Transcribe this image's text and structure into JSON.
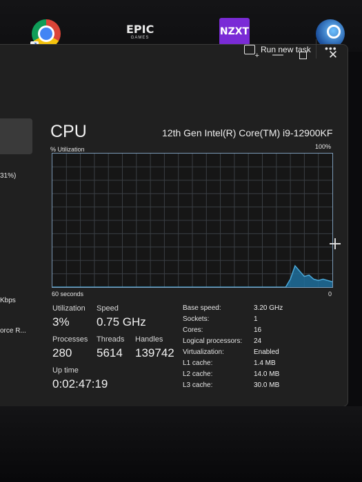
{
  "desktop": {
    "icons": [
      {
        "name": "chrome-icon"
      },
      {
        "name": "epic-games-icon",
        "text1": "EPIC",
        "text2": "GAMES"
      },
      {
        "name": "nzxt-icon",
        "text": "NZXT"
      },
      {
        "name": "steam-icon"
      }
    ]
  },
  "window": {
    "min_glyph": "—",
    "close_glyph": "✕"
  },
  "toolbar": {
    "run_new_task": "Run new task",
    "more": "•••"
  },
  "sidebar": {
    "fragments": [
      "31%)",
      "Kbps",
      "orce R..."
    ]
  },
  "cpu": {
    "title": "CPU",
    "model": "12th Gen Intel(R) Core(TM) i9-12900KF",
    "util_label": "% Utilization",
    "max_label": "100%",
    "time_label": "60 seconds",
    "min_label": "0"
  },
  "chart_data": {
    "type": "area",
    "ylim": [
      0,
      100
    ],
    "xlabel": "60 seconds",
    "ylabel": "% Utilization",
    "x": [
      0,
      5,
      10,
      15,
      20,
      25,
      30,
      35,
      40,
      45,
      50,
      51,
      52,
      53,
      54,
      55,
      56,
      57,
      58,
      59,
      60
    ],
    "values": [
      0,
      0,
      0,
      0,
      0,
      0,
      0,
      0,
      0,
      0,
      0,
      6,
      16,
      12,
      8,
      9,
      6,
      5,
      6,
      5,
      4
    ],
    "grid": true,
    "fill_color": "#1f6f9c",
    "line_color": "#4aa8d8"
  },
  "stats": {
    "utilization": {
      "label": "Utilization",
      "value": "3%"
    },
    "speed": {
      "label": "Speed",
      "value": "0.75 GHz"
    },
    "processes": {
      "label": "Processes",
      "value": "280"
    },
    "threads": {
      "label": "Threads",
      "value": "5614"
    },
    "handles": {
      "label": "Handles",
      "value": "139742"
    },
    "uptime": {
      "label": "Up time",
      "value": "0:02:47:19"
    }
  },
  "specs": [
    {
      "key": "Base speed:",
      "value": "3.20 GHz"
    },
    {
      "key": "Sockets:",
      "value": "1"
    },
    {
      "key": "Cores:",
      "value": "16"
    },
    {
      "key": "Logical processors:",
      "value": "24"
    },
    {
      "key": "Virtualization:",
      "value": "Enabled"
    },
    {
      "key": "L1 cache:",
      "value": "1.4 MB"
    },
    {
      "key": "L2 cache:",
      "value": "14.0 MB"
    },
    {
      "key": "L3 cache:",
      "value": "30.0 MB"
    }
  ]
}
